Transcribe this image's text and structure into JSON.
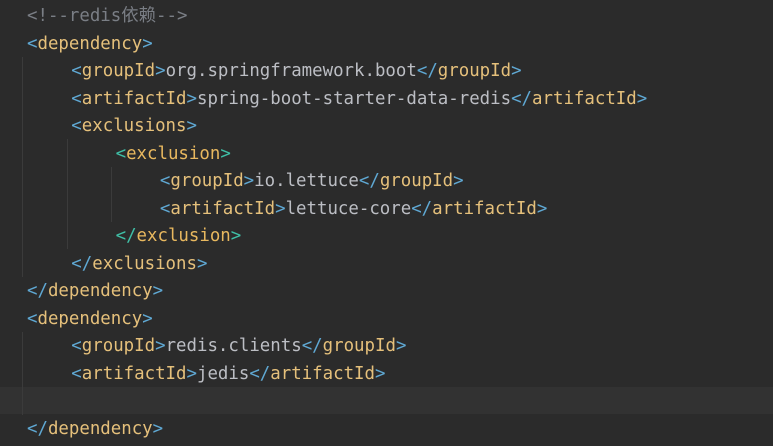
{
  "editor": {
    "lines": [
      {
        "indent": 0,
        "kind": "comment",
        "text": "<!--redis依赖-->"
      },
      {
        "indent": 0,
        "kind": "open",
        "tag": "dependency"
      },
      {
        "indent": 1,
        "kind": "elem",
        "tag": "groupId",
        "value": "org.springframework.boot"
      },
      {
        "indent": 1,
        "kind": "elem",
        "tag": "artifactId",
        "value": "spring-boot-starter-data-redis"
      },
      {
        "indent": 1,
        "kind": "open",
        "tag": "exclusions"
      },
      {
        "indent": 2,
        "kind": "open",
        "tag": "exclusion"
      },
      {
        "indent": 3,
        "kind": "elem",
        "tag": "groupId",
        "value": "io.lettuce"
      },
      {
        "indent": 3,
        "kind": "elem",
        "tag": "artifactId",
        "value": "lettuce-core"
      },
      {
        "indent": 2,
        "kind": "close",
        "tag": "exclusion"
      },
      {
        "indent": 1,
        "kind": "close",
        "tag": "exclusions"
      },
      {
        "indent": 0,
        "kind": "close",
        "tag": "dependency"
      },
      {
        "indent": 0,
        "kind": "open",
        "tag": "dependency"
      },
      {
        "indent": 1,
        "kind": "elem",
        "tag": "groupId",
        "value": "redis.clients"
      },
      {
        "indent": 1,
        "kind": "elem",
        "tag": "artifactId",
        "value": "jedis"
      },
      {
        "indent": 1,
        "kind": "blank"
      },
      {
        "indent": 0,
        "kind": "close",
        "tag": "dependency"
      }
    ],
    "current_line_index": 14,
    "colors": {
      "background": "#2b2b2b",
      "current_line": "#323232",
      "bracket": "#5fa8d3",
      "tag_name": "#e5c07b",
      "text": "#bcbec4",
      "comment": "#7a7e85",
      "exclusion_bracket": "#3fbfa6"
    }
  }
}
